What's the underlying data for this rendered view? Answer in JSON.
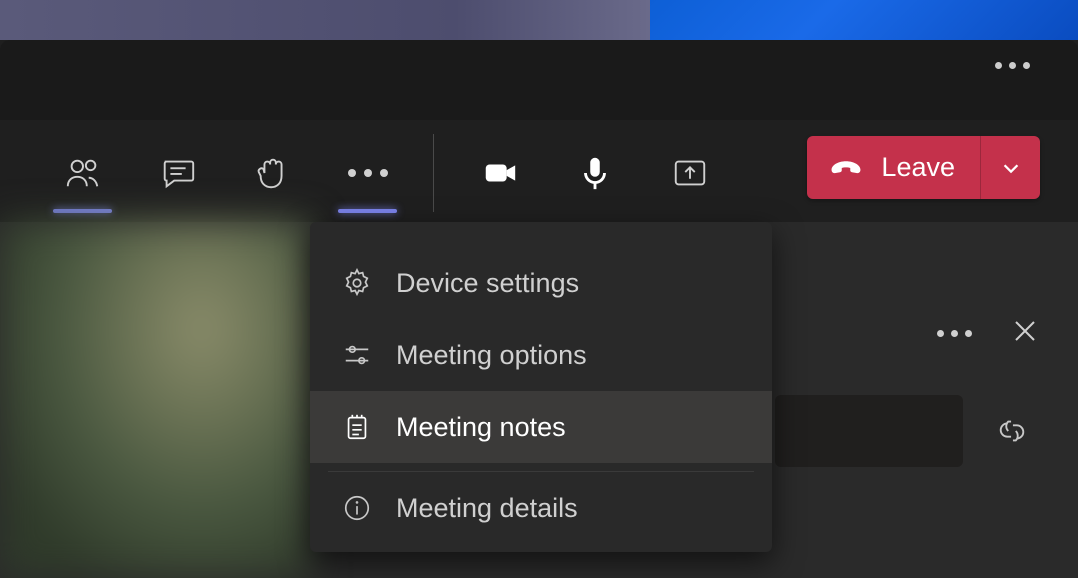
{
  "toolbar": {
    "leave_label": "Leave",
    "icons": {
      "people": "people-icon",
      "chat": "chat-icon",
      "raise_hand": "raise-hand-icon",
      "more": "more-icon",
      "camera": "camera-icon",
      "mic": "mic-icon",
      "share": "share-screen-icon"
    }
  },
  "menu": {
    "items": [
      {
        "label": "Device settings",
        "icon": "gear-icon",
        "hover": false
      },
      {
        "label": "Meeting options",
        "icon": "sliders-icon",
        "hover": false
      },
      {
        "label": "Meeting notes",
        "icon": "notes-icon",
        "hover": true
      },
      {
        "label": "Meeting details",
        "icon": "info-icon",
        "hover": false
      }
    ]
  },
  "colors": {
    "accent": "#7b83eb",
    "danger": "#c4314b",
    "bg_dark": "#1f1f1f",
    "menu_bg": "#292929",
    "menu_hover": "#3b3a39"
  }
}
